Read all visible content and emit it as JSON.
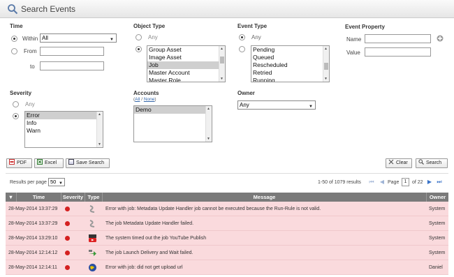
{
  "header": {
    "title": "Search Events"
  },
  "time": {
    "label": "Time",
    "within_label": "Within",
    "within_value": "All",
    "from_label": "From",
    "to_label": "to"
  },
  "object_type": {
    "label": "Object Type",
    "any_label": "Any",
    "options": [
      "Group Asset",
      "Image Asset",
      "Job",
      "Master Account",
      "Master Role"
    ],
    "selected": "Job"
  },
  "event_type": {
    "label": "Event Type",
    "any_label": "Any",
    "options": [
      "Pending",
      "Queued",
      "Rescheduled",
      "Retried",
      "Running"
    ]
  },
  "event_property": {
    "label": "Event Property",
    "name_label": "Name",
    "value_label": "Value"
  },
  "severity": {
    "label": "Severity",
    "any_label": "Any",
    "options": [
      "Error",
      "Info",
      "Warn"
    ],
    "selected": "Error"
  },
  "accounts": {
    "label": "Accounts",
    "all_link": "All",
    "slash": "/",
    "none_link": "None",
    "options": [
      "Demo"
    ]
  },
  "owner": {
    "label": "Owner",
    "value": "Any"
  },
  "toolbar": {
    "pdf": "PDF",
    "excel": "Excel",
    "save_search": "Save Search",
    "clear": "Clear",
    "search": "Search"
  },
  "results": {
    "per_page_label": "Results per page",
    "per_page_value": "50",
    "summary": "1-50 of 1079 results",
    "page_label": "Page",
    "page_value": "1",
    "of_pages": "of 22"
  },
  "table": {
    "headers": [
      "Time",
      "Severity",
      "Type",
      "Message",
      "Owner"
    ],
    "rows": [
      {
        "time": "28-May-2014 13:37:29",
        "type_icon": "job-icon",
        "message": "Error with job: Metadata Update Handler job cannot be executed because the Run-Rule is not valid.",
        "owner": "System"
      },
      {
        "time": "28-May-2014 13:37:29",
        "type_icon": "job-icon",
        "message": "The job Metadata Update Handler failed.",
        "owner": "System"
      },
      {
        "time": "28-May-2014 13:29:10",
        "type_icon": "youtube-icon",
        "message": "The system timed out the job YouTube Publish",
        "owner": "System"
      },
      {
        "time": "28-May-2014 12:14:12",
        "type_icon": "delivery-icon",
        "message": "The job Launch Delivery and Wait failed.",
        "owner": "System"
      },
      {
        "time": "28-May-2014 12:14:11",
        "type_icon": "globe-icon",
        "message": "Error with job: did not get upload url",
        "owner": "Daniel"
      }
    ]
  },
  "colors": {
    "row_error": "#fadadd",
    "header_bg": "#7a7a7a",
    "severity_error": "#d42020"
  }
}
